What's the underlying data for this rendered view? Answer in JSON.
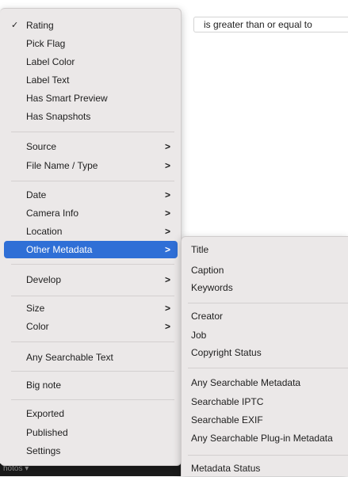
{
  "condition": {
    "value": "is greater than or equal to"
  },
  "filmstrip": {
    "label": "hotos ▾"
  },
  "main_menu": {
    "rating": "Rating",
    "pick_flag": "Pick Flag",
    "label_color": "Label Color",
    "label_text": "Label Text",
    "has_smart_preview": "Has Smart Preview",
    "has_snapshots": "Has Snapshots",
    "source": "Source",
    "file_name_type": "File Name / Type",
    "date": "Date",
    "camera_info": "Camera Info",
    "location": "Location",
    "other_metadata": "Other Metadata",
    "develop": "Develop",
    "size": "Size",
    "color": "Color",
    "any_searchable_text": "Any Searchable Text",
    "big_note": "Big note",
    "exported": "Exported",
    "published": "Published",
    "settings": "Settings",
    "checkmark": "✓",
    "chevron": ">"
  },
  "sub_menu": {
    "title": "Title",
    "caption": "Caption",
    "keywords": "Keywords",
    "creator": "Creator",
    "job": "Job",
    "copyright_status": "Copyright Status",
    "any_searchable_metadata": "Any Searchable Metadata",
    "searchable_iptc": "Searchable IPTC",
    "searchable_exif": "Searchable EXIF",
    "any_searchable_plugin_metadata": "Any Searchable Plug-in Metadata",
    "metadata_status": "Metadata Status"
  },
  "colors": {
    "highlight": "#2f6fd6",
    "menu_bg": "#ebe8e8"
  }
}
